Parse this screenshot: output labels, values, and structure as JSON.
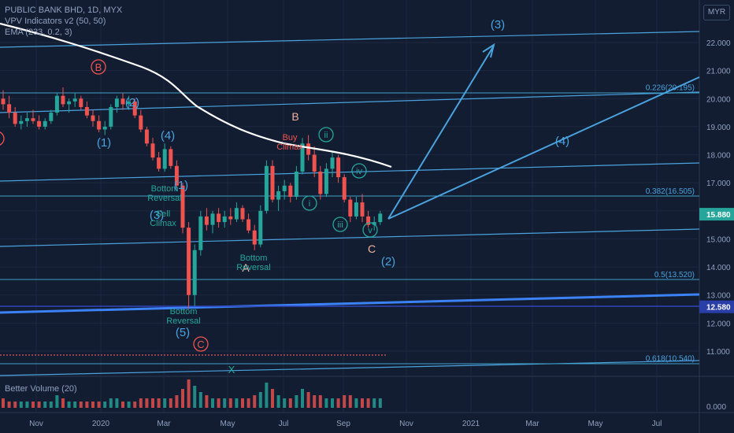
{
  "legend": {
    "title": "PUBLIC BANK BHD, 1D, MYX",
    "indicator1": "VPV Indicators v2 (50, 50)",
    "indicator2": "EMA (233, 0.2, 3)"
  },
  "currency_button": "MYR",
  "volume_label": "Better Volume (20)",
  "chart_data": {
    "type": "candlestick",
    "price_axis": {
      "ticks": [
        "22.000",
        "21.000",
        "20.000",
        "19.000",
        "18.000",
        "17.000",
        "16.000",
        "15.000",
        "14.000",
        "13.000",
        "12.000",
        "11.000"
      ],
      "ylim": [
        10.2,
        23.0
      ]
    },
    "time_axis": {
      "ticks": [
        "Nov",
        "2020",
        "Mar",
        "May",
        "Jul",
        "Sep",
        "Nov",
        "2021",
        "Mar",
        "May",
        "Jul"
      ]
    },
    "price_badges": [
      {
        "value": "15.880",
        "color": "#26a69a"
      },
      {
        "value": "12.580",
        "color": "#2a3ea8"
      }
    ],
    "fib_levels": [
      {
        "label": "0.226(20.195)",
        "price": 20.195
      },
      {
        "label": "0.382(16.505)",
        "price": 16.505
      },
      {
        "label": "0.5(13.520)",
        "price": 13.52
      },
      {
        "label": "0.618(10.540)",
        "price": 10.54
      }
    ],
    "wave_labels_blue": [
      "(1)",
      "(2)",
      "(3)",
      "(4)",
      "(5)",
      "(1)",
      "(2)",
      "(3)",
      "(4)"
    ],
    "wave_labels_circled_red": [
      "B",
      "C"
    ],
    "wave_labels_orange": [
      "A",
      "B",
      "C"
    ],
    "wave_labels_green_circled": [
      "i",
      "ii",
      "iii",
      "iv",
      "v"
    ],
    "annotations_green": [
      "Bottom Reversal",
      "Sell Climax",
      "Bottom Reversal",
      "Bottom Reversal",
      "X"
    ],
    "annotations_red": [
      "Buy Climax"
    ],
    "volume_axis_tick": "0.000",
    "candles": [
      [
        0,
        20.0,
        20.3,
        19.6,
        19.8
      ],
      [
        1,
        19.8,
        20.1,
        19.3,
        19.5
      ],
      [
        2,
        19.5,
        19.7,
        19.0,
        19.1
      ],
      [
        3,
        19.1,
        19.4,
        18.9,
        19.2
      ],
      [
        4,
        19.2,
        19.5,
        19.0,
        19.3
      ],
      [
        5,
        19.3,
        19.6,
        19.1,
        19.2
      ],
      [
        6,
        19.2,
        19.4,
        18.9,
        19.0
      ],
      [
        7,
        19.0,
        19.3,
        18.9,
        19.2
      ],
      [
        8,
        19.2,
        19.6,
        19.1,
        19.5
      ],
      [
        9,
        19.5,
        20.2,
        19.4,
        20.1
      ],
      [
        10,
        20.1,
        20.4,
        19.7,
        19.8
      ],
      [
        11,
        19.8,
        20.0,
        19.5,
        19.9
      ],
      [
        12,
        19.9,
        20.2,
        19.7,
        20.0
      ],
      [
        13,
        20.0,
        20.1,
        19.6,
        19.7
      ],
      [
        14,
        19.7,
        19.9,
        19.3,
        19.4
      ],
      [
        15,
        19.4,
        19.6,
        19.0,
        19.2
      ],
      [
        16,
        19.2,
        19.4,
        18.8,
        18.9
      ],
      [
        17,
        18.9,
        19.2,
        18.7,
        19.0
      ],
      [
        18,
        19.0,
        19.8,
        18.9,
        19.7
      ],
      [
        19,
        19.7,
        20.1,
        19.5,
        20.0
      ],
      [
        20,
        20.0,
        20.2,
        19.6,
        19.8
      ],
      [
        21,
        19.8,
        20.1,
        19.6,
        19.9
      ],
      [
        22,
        19.9,
        20.0,
        19.3,
        19.4
      ],
      [
        23,
        19.4,
        19.6,
        18.8,
        18.9
      ],
      [
        24,
        18.9,
        19.0,
        18.3,
        18.4
      ],
      [
        25,
        18.4,
        18.6,
        17.8,
        17.9
      ],
      [
        26,
        17.9,
        18.1,
        17.4,
        17.5
      ],
      [
        27,
        17.5,
        18.4,
        17.4,
        18.2
      ],
      [
        28,
        18.2,
        18.3,
        17.5,
        17.6
      ],
      [
        29,
        17.6,
        17.8,
        16.8,
        16.9
      ],
      [
        30,
        16.9,
        17.0,
        15.2,
        15.4
      ],
      [
        31,
        15.4,
        15.6,
        12.5,
        13.0
      ],
      [
        32,
        13.0,
        14.8,
        12.6,
        14.6
      ],
      [
        33,
        14.6,
        16.0,
        14.4,
        15.8
      ],
      [
        34,
        15.8,
        16.1,
        15.3,
        15.5
      ],
      [
        35,
        15.5,
        16.0,
        15.2,
        15.9
      ],
      [
        36,
        15.9,
        16.1,
        15.4,
        15.6
      ],
      [
        37,
        15.6,
        16.0,
        15.4,
        15.8
      ],
      [
        38,
        15.8,
        16.1,
        15.5,
        15.7
      ],
      [
        39,
        15.7,
        16.3,
        15.6,
        16.1
      ],
      [
        40,
        16.1,
        16.2,
        15.6,
        15.7
      ],
      [
        41,
        15.7,
        15.9,
        15.2,
        15.3
      ],
      [
        42,
        15.3,
        15.5,
        14.6,
        14.8
      ],
      [
        43,
        14.8,
        16.2,
        14.7,
        16.0
      ],
      [
        44,
        16.0,
        17.8,
        15.9,
        17.6
      ],
      [
        45,
        17.6,
        17.8,
        16.3,
        16.4
      ],
      [
        46,
        16.4,
        16.9,
        16.0,
        16.7
      ],
      [
        47,
        16.7,
        17.1,
        16.4,
        16.9
      ],
      [
        48,
        16.9,
        17.0,
        16.3,
        16.5
      ],
      [
        49,
        16.5,
        17.6,
        16.4,
        17.4
      ],
      [
        50,
        17.4,
        18.6,
        17.3,
        18.4
      ],
      [
        51,
        18.4,
        18.7,
        17.8,
        18.0
      ],
      [
        52,
        18.0,
        18.3,
        17.2,
        17.4
      ],
      [
        53,
        17.4,
        17.6,
        16.4,
        16.6
      ],
      [
        54,
        16.6,
        17.7,
        16.5,
        17.5
      ],
      [
        55,
        17.5,
        18.1,
        17.2,
        17.9
      ],
      [
        56,
        17.9,
        18.0,
        17.0,
        17.2
      ],
      [
        57,
        17.2,
        17.3,
        16.3,
        16.4
      ],
      [
        58,
        16.4,
        16.5,
        15.6,
        15.8
      ],
      [
        59,
        15.8,
        16.5,
        15.7,
        16.3
      ],
      [
        60,
        16.3,
        16.6,
        15.6,
        15.8
      ],
      [
        61,
        15.8,
        16.0,
        15.4,
        15.5
      ],
      [
        62,
        15.5,
        15.8,
        15.3,
        15.6
      ],
      [
        63,
        15.6,
        16.0,
        15.5,
        15.9
      ]
    ],
    "volume": [
      3,
      2,
      2,
      2,
      2,
      2,
      2,
      2,
      2,
      4,
      3,
      2,
      2,
      2,
      2,
      2,
      2,
      2,
      3,
      3,
      2,
      2,
      2,
      3,
      3,
      3,
      3,
      3,
      3,
      4,
      6,
      9,
      7,
      5,
      4,
      3,
      3,
      3,
      3,
      3,
      3,
      3,
      4,
      5,
      8,
      6,
      4,
      3,
      3,
      4,
      6,
      5,
      4,
      4,
      3,
      3,
      3,
      4,
      4,
      3,
      3,
      3,
      3,
      3
    ]
  }
}
